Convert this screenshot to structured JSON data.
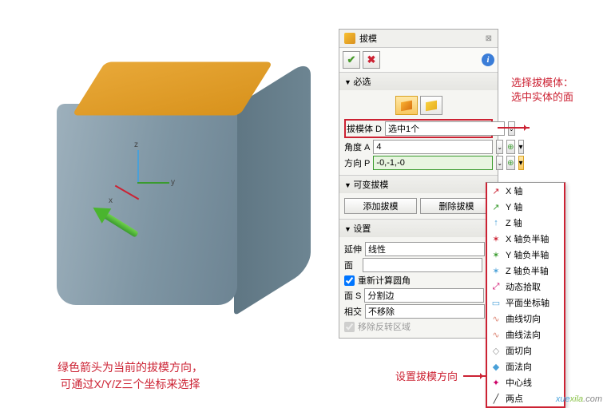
{
  "window": {
    "title": "拔模",
    "close_glyph": "⊠"
  },
  "actions": {
    "ok": "✔",
    "cancel": "✖",
    "info": "i"
  },
  "sections": {
    "required": {
      "title": "必选"
    },
    "variable": {
      "title": "可变拔模",
      "add": "添加拔模",
      "remove": "删除拔模"
    },
    "settings": {
      "title": "设置"
    }
  },
  "fields": {
    "body": {
      "label": "拔模体 D",
      "value": "选中1个"
    },
    "angle": {
      "label": "角度 A",
      "value": "4"
    },
    "direction": {
      "label": "方向 P",
      "value": "-0,-1,-0"
    },
    "extend": {
      "label": "延伸",
      "value": "线性"
    },
    "face": {
      "label": "面",
      "value": ""
    },
    "recompute": {
      "label": "重新计算圆角",
      "checked": true
    },
    "face_s": {
      "label": "面 S",
      "value": "分割边"
    },
    "intersect": {
      "label": "相交",
      "value": "不移除"
    },
    "remove_reverse": {
      "label": "移除反转区域",
      "checked": true
    }
  },
  "menu": {
    "items": [
      {
        "icon": "↗",
        "color": "#c23",
        "label": "X 轴"
      },
      {
        "icon": "↗",
        "color": "#3a9b2e",
        "label": "Y 轴"
      },
      {
        "icon": "↑",
        "color": "#49a0d8",
        "label": "Z 轴"
      },
      {
        "icon": "✶",
        "color": "#c23",
        "label": "X 轴负半轴"
      },
      {
        "icon": "✶",
        "color": "#3a9b2e",
        "label": "Y 轴负半轴"
      },
      {
        "icon": "✶",
        "color": "#49a0d8",
        "label": "Z 轴负半轴"
      },
      {
        "icon": "⤢",
        "color": "#c06",
        "label": "动态拾取"
      },
      {
        "icon": "▭",
        "color": "#49a0d8",
        "label": "平面坐标轴"
      },
      {
        "icon": "∿",
        "color": "#d87",
        "label": "曲线切向"
      },
      {
        "icon": "∿",
        "color": "#d87",
        "label": "曲线法向"
      },
      {
        "icon": "◇",
        "color": "#999",
        "label": "面切向"
      },
      {
        "icon": "◆",
        "color": "#49a0d8",
        "label": "面法向"
      },
      {
        "icon": "✦",
        "color": "#c06",
        "label": "中心线"
      },
      {
        "icon": "╱",
        "color": "#333",
        "label": "两点"
      }
    ]
  },
  "callouts": {
    "select_body": "选择拔模体：\n选中实体的面",
    "set_direction": "设置拔模方向",
    "green_arrow": "绿色箭头为当前的拔模方向，\n可通过X/Y/Z三个坐标来选择"
  },
  "axis_labels": {
    "x": "x",
    "y": "y",
    "z": "z"
  },
  "watermark": {
    "a": "xue",
    "b": "xila",
    "c": ".com"
  }
}
